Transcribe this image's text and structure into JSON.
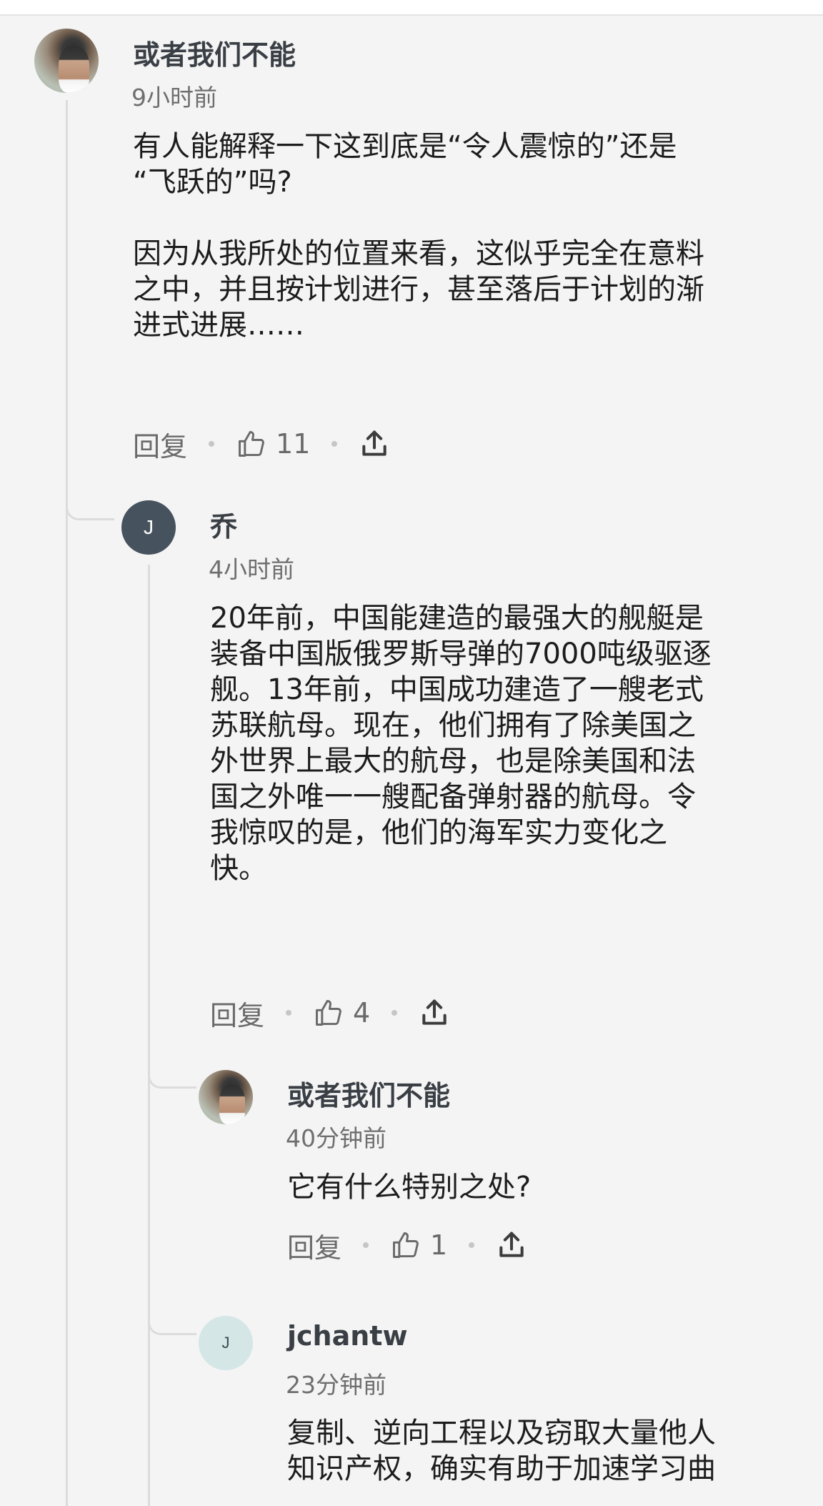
{
  "comments": [
    {
      "username": "或者我们不能",
      "time": "9小时前",
      "avatar": "photo",
      "body": [
        "有人能解释一下这到底是“令人震惊的”还是",
        "“飞跃的”吗?",
        "",
        "因为从我所处的位置来看，这似乎完全在意料",
        "之中，并且按计划进行，甚至落后于计划的渐",
        "进式进展……"
      ],
      "reply_label": "回复",
      "likes": "11",
      "icons": [
        "thumbs-up-icon",
        "share-icon"
      ]
    },
    {
      "username": "乔",
      "time": "4小时前",
      "avatar_letter": "J",
      "body": [
        "20年前，中国能建造的最强大的舰艇是",
        "装备中国版俄罗斯导弹的7000吨级驱逐",
        "舰。13年前，中国成功建造了一艘老式",
        "苏联航母。现在，他们拥有了除美国之",
        "外世界上最大的航母，也是除美国和法",
        "国之外唯一一艘配备弹射器的航母。令",
        "我惊叹的是，他们的海军实力变化之",
        "快。"
      ],
      "reply_label": "回复",
      "likes": "4"
    },
    {
      "username": "或者我们不能",
      "time": "40分钟前",
      "avatar": "photo",
      "body": [
        "它有什么特别之处?"
      ],
      "reply_label": "回复",
      "likes": "1"
    },
    {
      "username": "jchantw",
      "time": "23分钟前",
      "avatar_letter": "J",
      "body": [
        "复制、逆向工程以及窃取大量他人",
        "知识产权，确实有助于加速学习曲"
      ]
    }
  ],
  "colors": {
    "background": "#f4f4f4",
    "thread_line": "#dcdcdc",
    "avatar_dark": "#46525e",
    "avatar_light": "#d4e6e6"
  }
}
